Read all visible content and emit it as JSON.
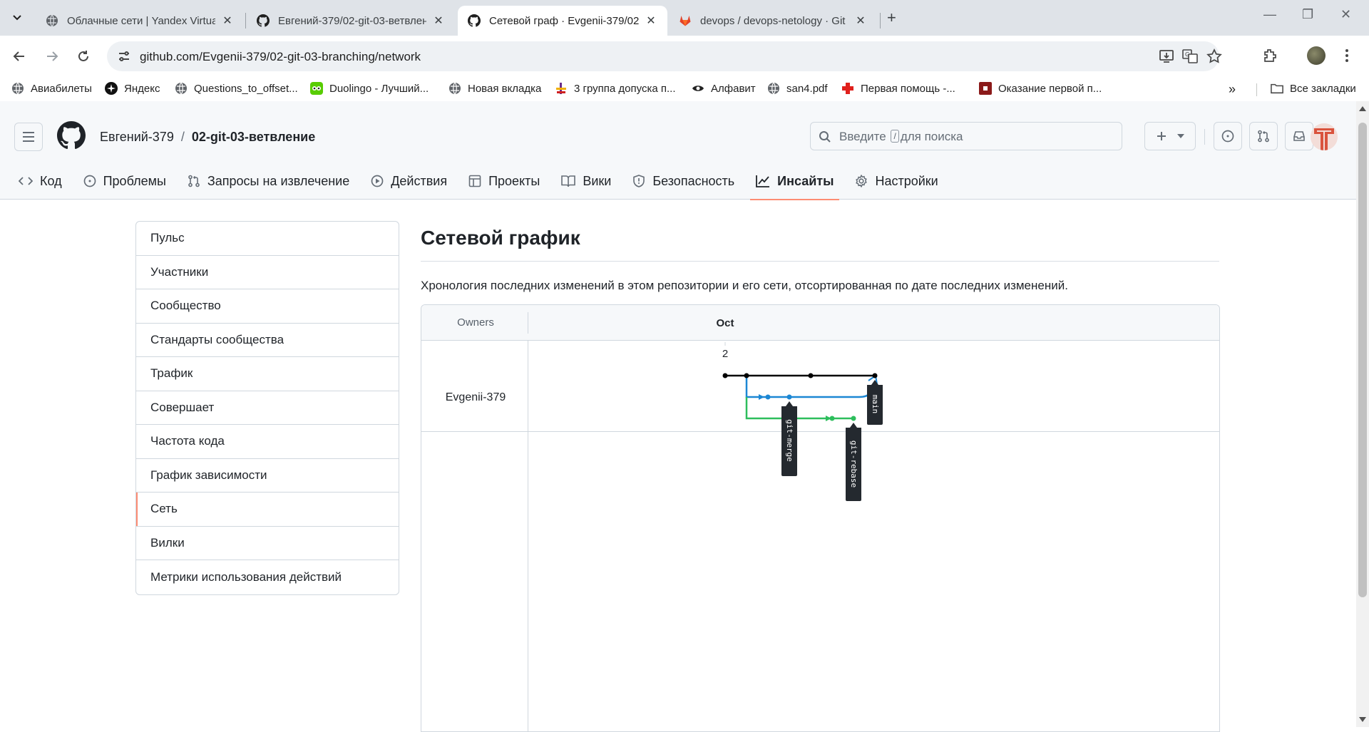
{
  "browser": {
    "tabs": [
      {
        "title": "Облачные сети | Yandex Virtua",
        "active": false
      },
      {
        "title": "Евгений-379/02-git-03-ветвлен",
        "active": false
      },
      {
        "title": "Сетевой граф · Evgenii-379/02-",
        "active": true
      },
      {
        "title": "devops / devops-netology · Git",
        "active": false
      }
    ],
    "url": "github.com/Evgenii-379/02-git-03-branching/network",
    "bookmarks": [
      {
        "label": "Авиабилеты"
      },
      {
        "label": "Яндекс"
      },
      {
        "label": "Questions_to_offset..."
      },
      {
        "label": "Duolingo - Лучший..."
      },
      {
        "label": "Новая вкладка"
      },
      {
        "label": "3 группа допуска п..."
      },
      {
        "label": "Алфавит"
      },
      {
        "label": "san4.pdf"
      },
      {
        "label": "Первая помощь -..."
      },
      {
        "label": "Оказание первой п..."
      }
    ],
    "all_bookmarks": "Все закладки"
  },
  "github": {
    "owner": "Евгений-379",
    "separator": "/",
    "repo": "02-git-03-ветвление",
    "search_placeholder_before": "Введите",
    "search_key": "/",
    "search_placeholder_after": "для поиска",
    "nav": [
      {
        "label": "Код",
        "icon": "code-icon"
      },
      {
        "label": "Проблемы",
        "icon": "issue-icon"
      },
      {
        "label": "Запросы на извлечение",
        "icon": "pull-request-icon"
      },
      {
        "label": "Действия",
        "icon": "play-icon"
      },
      {
        "label": "Проекты",
        "icon": "table-icon"
      },
      {
        "label": "Вики",
        "icon": "book-icon"
      },
      {
        "label": "Безопасность",
        "icon": "shield-icon"
      },
      {
        "label": "Инсайты",
        "icon": "graph-icon",
        "active": true
      },
      {
        "label": "Настройки",
        "icon": "gear-icon"
      }
    ]
  },
  "sidebar": {
    "items": [
      {
        "label": "Пульс"
      },
      {
        "label": "Участники"
      },
      {
        "label": "Сообщество"
      },
      {
        "label": "Стандарты сообщества"
      },
      {
        "label": "Трафик"
      },
      {
        "label": "Совершает"
      },
      {
        "label": "Частота кода"
      },
      {
        "label": "График зависимости"
      },
      {
        "label": "Сеть",
        "selected": true
      },
      {
        "label": "Вилки"
      },
      {
        "label": "Метрики использования действий"
      }
    ]
  },
  "main": {
    "title": "Сетевой график",
    "description": "Хронология последних изменений в этом репозитории и его сети, отсортированная по дате последних изменений."
  },
  "network": {
    "owners_header": "Owners",
    "month": "Oct",
    "day": "2",
    "owner": "Evgenii-379",
    "branches": [
      {
        "name": "main",
        "color": "#000000"
      },
      {
        "name": "git-merge",
        "color": "#1c87d4"
      },
      {
        "name": "git-rebase",
        "color": "#2dbe5c"
      }
    ]
  },
  "colors": {
    "accent_underline": "#fd8c73",
    "main_line": "#000000",
    "merge_line": "#1c87d4",
    "rebase_line": "#2dbe5c",
    "label_bg": "#24292f"
  }
}
